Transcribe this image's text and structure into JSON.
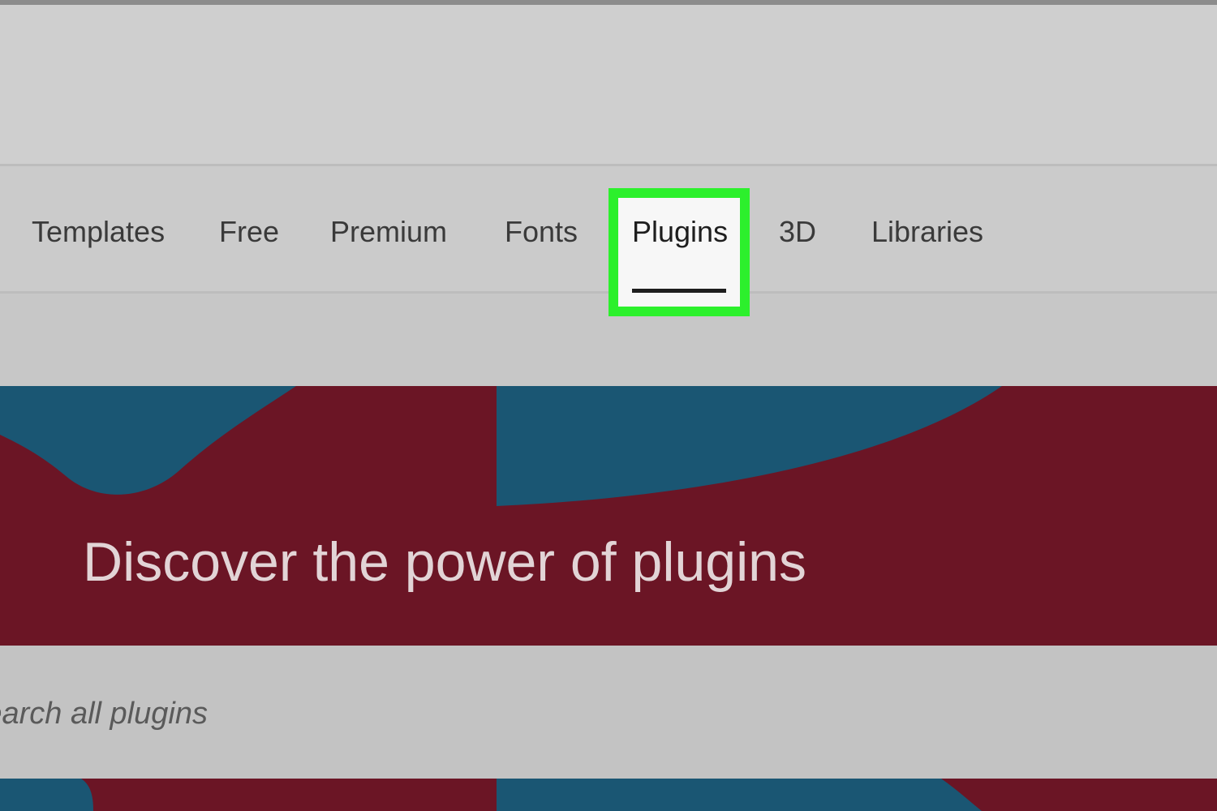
{
  "nav": {
    "tabs": [
      {
        "label": "Templates"
      },
      {
        "label": "Free"
      },
      {
        "label": "Premium"
      },
      {
        "label": "Fonts"
      },
      {
        "label": "Plugins",
        "selected": true,
        "highlight_color": "#2cf02c"
      },
      {
        "label": "3D"
      },
      {
        "label": "Libraries"
      }
    ]
  },
  "banner": {
    "title": "Discover the power of plugins",
    "background_color": "#6b1525",
    "accent_color": "#1a5673"
  },
  "search": {
    "placeholder": "Search all plugins"
  }
}
